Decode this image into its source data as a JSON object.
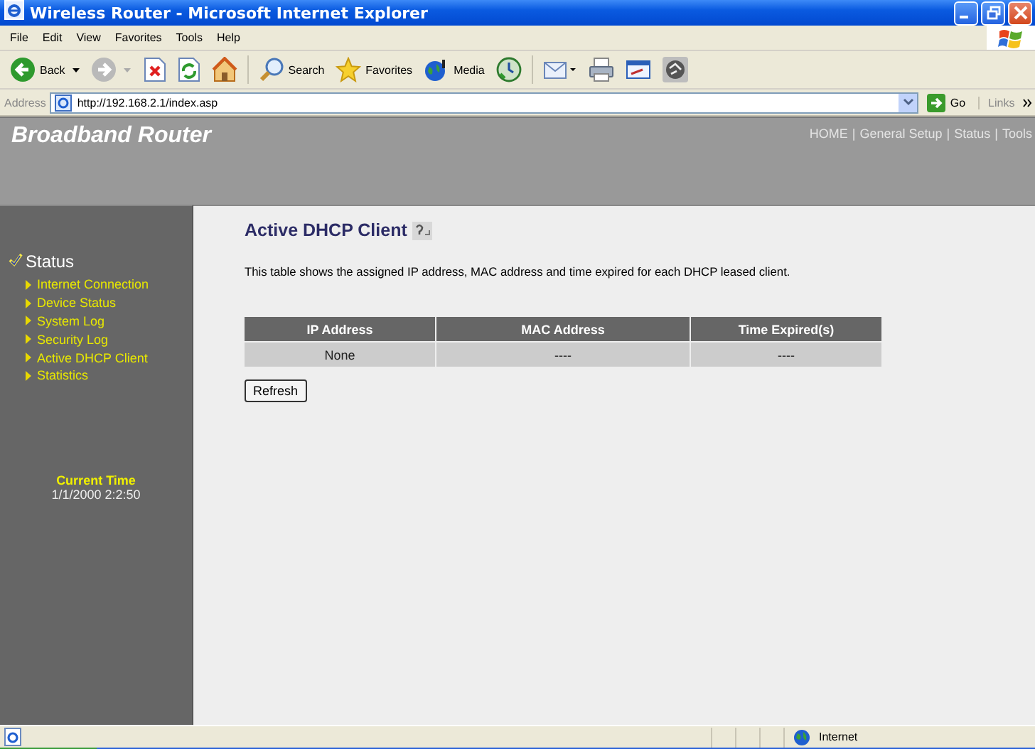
{
  "window": {
    "title": "Wireless Router - Microsoft Internet Explorer"
  },
  "menu": [
    "File",
    "Edit",
    "View",
    "Favorites",
    "Tools",
    "Help"
  ],
  "toolbar": [
    {
      "kind": "back",
      "label": "Back"
    },
    {
      "kind": "forward"
    },
    {
      "kind": "stop"
    },
    {
      "kind": "refresh"
    },
    {
      "kind": "home"
    },
    {
      "kind": "search",
      "label": "Search"
    },
    {
      "kind": "favorites",
      "label": "Favorites"
    },
    {
      "kind": "media",
      "label": "Media"
    },
    {
      "kind": "history"
    },
    {
      "kind": "mail"
    },
    {
      "kind": "print"
    },
    {
      "kind": "edit"
    },
    {
      "kind": "messenger"
    }
  ],
  "address_bar": {
    "label": "Address",
    "value": "http://192.168.2.1/index.asp",
    "go": "Go",
    "links": "Links"
  },
  "router": {
    "brand": "Broadband Router",
    "nav": [
      "HOME",
      "General Setup",
      "Status",
      "Tools"
    ],
    "nav_separator": "|"
  },
  "sidebar": {
    "section": {
      "label": "Status",
      "checked": true
    },
    "items": [
      "Internet Connection",
      "Device Status",
      "System Log",
      "Security Log",
      "Active DHCP Client",
      "Statistics"
    ],
    "current_time": {
      "label": "Current Time",
      "value": "1/1/2000 2:2:50"
    }
  },
  "content": {
    "heading": "Active DHCP Client",
    "description": "This table shows the assigned IP address, MAC address and time expired for each DHCP leased client.",
    "table": {
      "columns": [
        "IP Address",
        "MAC Address",
        "Time Expired(s)"
      ],
      "rows": [
        [
          "None",
          "----",
          "----"
        ]
      ]
    },
    "button": "Refresh"
  },
  "status_bar": {
    "zone": "Internet"
  }
}
